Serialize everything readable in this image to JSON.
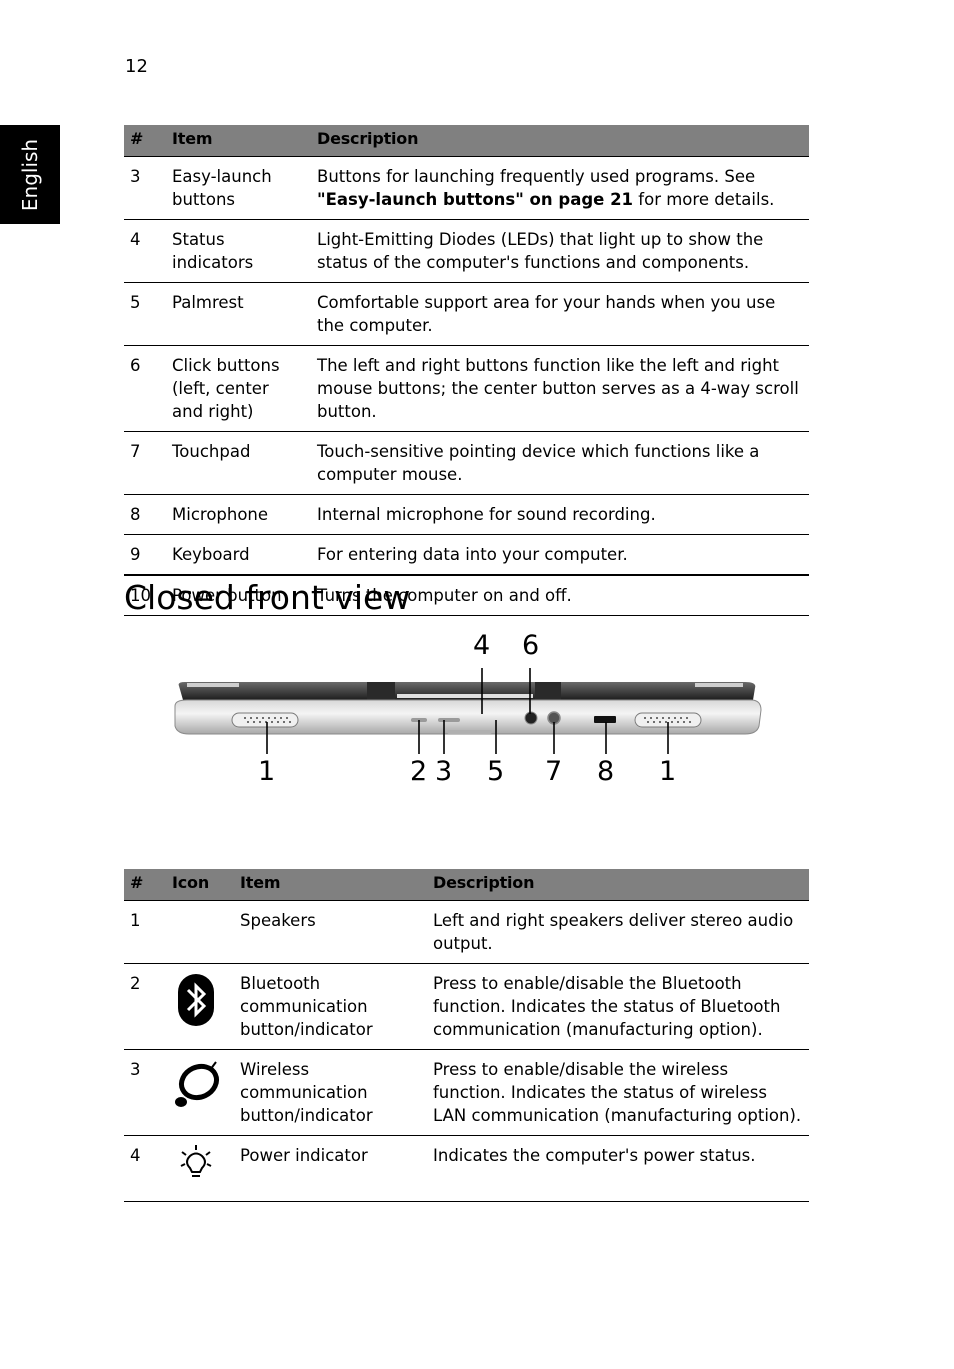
{
  "page": {
    "number": "12",
    "language_tab": "English"
  },
  "table1": {
    "headers": [
      "#",
      "Item",
      "Description"
    ],
    "rows": [
      {
        "num": "3",
        "item": "Easy-launch buttons",
        "desc_pre": "Buttons for launching frequently used programs. See ",
        "desc_bold": "\"Easy-launch buttons\" on page 21",
        "desc_post": " for more details."
      },
      {
        "num": "4",
        "item": "Status indicators",
        "desc": "Light-Emitting Diodes (LEDs) that light up to show the status of the computer's functions and components."
      },
      {
        "num": "5",
        "item": "Palmrest",
        "desc": "Comfortable support area for your hands when you use the computer."
      },
      {
        "num": "6",
        "item": "Click buttons (left, center and right)",
        "desc": "The left and right buttons function like the left and right mouse buttons; the center button serves as a 4-way scroll button."
      },
      {
        "num": "7",
        "item": "Touchpad",
        "desc": "Touch-sensitive pointing device which functions like a computer mouse."
      },
      {
        "num": "8",
        "item": "Microphone",
        "desc": "Internal microphone for sound recording."
      },
      {
        "num": "9",
        "item": "Keyboard",
        "desc": "For entering data into your computer."
      },
      {
        "num": "10",
        "item": "Power button",
        "desc": "Turns the computer on and off."
      }
    ]
  },
  "section": {
    "title": "Closed front view"
  },
  "figure": {
    "description": "Closed front view of laptop with numbered callouts",
    "callouts_top": [
      "4",
      "6"
    ],
    "callouts_bottom": [
      "1",
      "2",
      "3",
      "5",
      "7",
      "8",
      "1"
    ]
  },
  "table2": {
    "headers": [
      "#",
      "Icon",
      "Item",
      "Description"
    ],
    "rows": [
      {
        "num": "1",
        "icon": "",
        "item": "Speakers",
        "desc": "Left and right speakers deliver stereo audio output."
      },
      {
        "num": "2",
        "icon": "bluetooth-icon",
        "item": "Bluetooth communication button/indicator",
        "desc": "Press to enable/disable the Bluetooth function. Indicates the status of Bluetooth communication (manufacturing option)."
      },
      {
        "num": "3",
        "icon": "wireless-icon",
        "item": "Wireless communication button/indicator",
        "desc": "Press to enable/disable the wireless function. Indicates the status of wireless LAN communication (manufacturing option)."
      },
      {
        "num": "4",
        "icon": "power-indicator-icon",
        "item": "Power indicator",
        "desc": "Indicates the computer's power status."
      }
    ]
  }
}
